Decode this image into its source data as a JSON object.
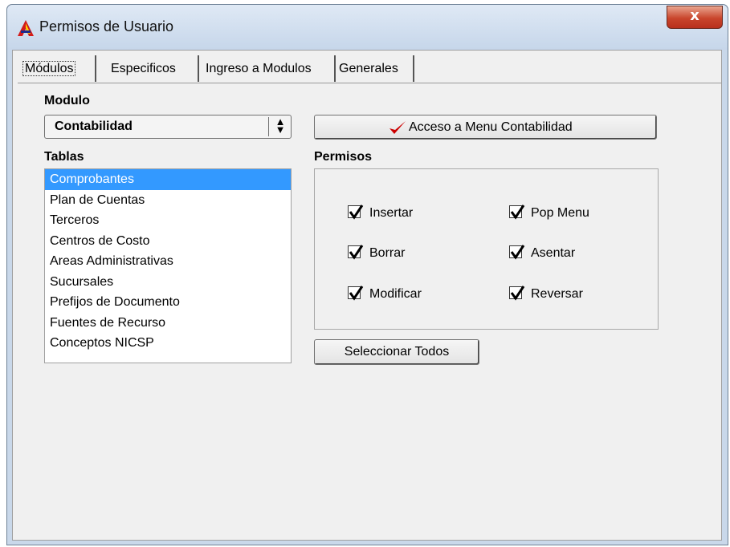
{
  "window": {
    "title": "Permisos de Usuario",
    "close_glyph": "x"
  },
  "tabs": [
    {
      "label": "Módulos"
    },
    {
      "label": "Especificos"
    },
    {
      "label": "Ingreso a Modulos"
    },
    {
      "label": "Generales"
    }
  ],
  "modulo": {
    "label": "Modulo",
    "selected": "Contabilidad",
    "access_button": "Acceso a Menu Contabilidad"
  },
  "tablas": {
    "label": "Tablas",
    "items": [
      "Comprobantes",
      "Plan de Cuentas",
      "Terceros",
      "Centros de Costo",
      "Areas Administrativas",
      "Sucursales",
      "Prefijos de Documento",
      "Fuentes de Recurso",
      "Conceptos NICSP"
    ]
  },
  "permisos": {
    "label": "Permisos",
    "checks": [
      {
        "label": "Insertar",
        "checked": true
      },
      {
        "label": "Borrar",
        "checked": true
      },
      {
        "label": "Modificar",
        "checked": true
      },
      {
        "label": "Pop Menu",
        "checked": true
      },
      {
        "label": "Asentar",
        "checked": true
      },
      {
        "label": "Reversar",
        "checked": true
      }
    ]
  },
  "select_all_button": "Seleccionar Todos",
  "colors": {
    "selection": "#3399ff",
    "check_accent": "#cc0000"
  }
}
